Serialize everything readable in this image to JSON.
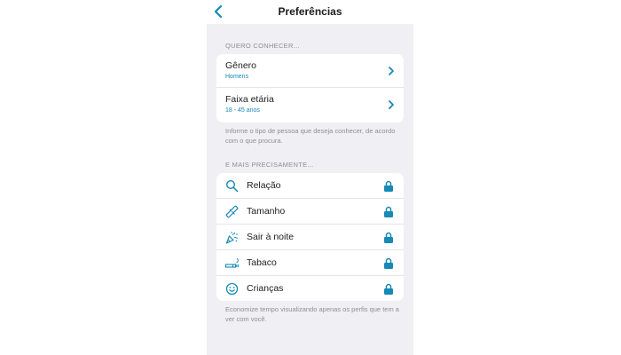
{
  "header": {
    "title": "Preferências",
    "back_icon": "chevron-left-icon"
  },
  "section1": {
    "label": "QUERO CONHECER...",
    "rows": [
      {
        "title": "Gênero",
        "value": "Homens"
      },
      {
        "title": "Faixa etária",
        "value": "18 - 45 anos"
      }
    ],
    "help": "Informe o tipo de pessoa que deseja conhecer, de acordo com o que procura."
  },
  "section2": {
    "label": "E MAIS PRECISAMENTE...",
    "rows": [
      {
        "label": "Relação",
        "icon": "search-icon"
      },
      {
        "label": "Tamanho",
        "icon": "ruler-icon"
      },
      {
        "label": "Sair à noite",
        "icon": "party-popper-icon"
      },
      {
        "label": "Tabaco",
        "icon": "cigarette-icon"
      },
      {
        "label": "Crianças",
        "icon": "smiley-icon"
      }
    ],
    "help": "Economize tempo visualizando apenas os perfis que tem a ver com você."
  },
  "colors": {
    "accent": "#1689b5",
    "background": "#efeff4",
    "text": "#1c1c1e",
    "muted": "#8e8e93"
  }
}
